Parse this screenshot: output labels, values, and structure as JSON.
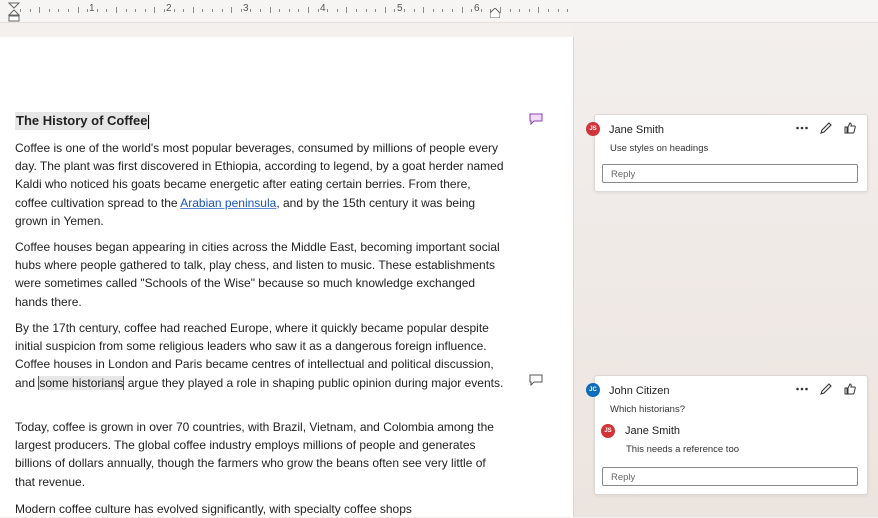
{
  "ruler": {
    "numbers": [
      "1",
      "2",
      "3",
      "4",
      "5",
      "6"
    ]
  },
  "document": {
    "title": "The History of Coffee",
    "paragraphs": {
      "p1_pre": "Coffee is one of the world's most popular beverages, consumed by millions of people every day. The plant was first discovered in Ethiopia, according to legend, by a goat herder named Kaldi who noticed his goats became energetic after eating certain berries. From there, coffee cultivation spread to the ",
      "p1_link": "Arabian peninsula",
      "p1_post": ", and by the 15th century it was being grown in Yemen.",
      "p2": "Coffee houses began appearing in cities across the Middle East, becoming important social hubs where people gathered to talk, play chess, and listen to music. These establishments were sometimes called \"Schools of the Wise\" because so much knowledge exchanged hands there.",
      "p3_pre": "By the 17th century, coffee had reached Europe, where it quickly became popular despite initial suspicion from some religious leaders who saw it as a dangerous foreign influence. Coffee houses in London and Paris became centres of intellectual and political discussion, and ",
      "p3_highlight": "some historians",
      "p3_post": " argue they played a role in shaping public opinion during major events.",
      "p4": "Today, coffee is grown in over 70 countries, with Brazil, Vietnam, and Colombia among the largest producers. The global coffee industry employs millions of people and generates billions of dollars annually, though the farmers who grow the beans often see very little of that revenue.",
      "p5": "Modern coffee culture has evolved significantly, with specialty coffee shops"
    }
  },
  "comments": [
    {
      "author": "Jane Smith",
      "initials": "JS",
      "avatar_color": "#d13438",
      "text": "Use styles on headings",
      "reply_placeholder": "Reply"
    },
    {
      "author": "John Citizen",
      "initials": "JC",
      "avatar_color": "#0f6cbd",
      "text": "Which historians?",
      "reply": {
        "author": "Jane Smith",
        "initials": "JS",
        "avatar_color": "#d13438",
        "text": "This needs a reference too"
      },
      "reply_placeholder": "Reply"
    }
  ],
  "colors": {
    "accent": "#7a3d9a",
    "link": "#1a53b5"
  }
}
